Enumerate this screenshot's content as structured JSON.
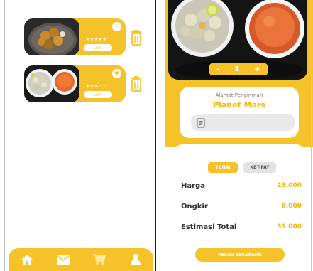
{
  "colors": {
    "accent": "#f6c229",
    "accent_text": "#f2b705",
    "dark": "#141414"
  },
  "favorites": {
    "items": [
      {
        "button_label": "LIHAT",
        "stars": "★★★★★",
        "favorite_icon": "heart-icon"
      },
      {
        "button_label": "LIHAT",
        "stars": "★★★☆☆",
        "favorite_icon": "heart-icon"
      }
    ],
    "delete_icon": "trash-icon"
  },
  "bottom_nav": {
    "items": [
      {
        "icon": "home-icon"
      },
      {
        "icon": "mail-icon"
      },
      {
        "icon": "cart-icon"
      },
      {
        "icon": "user-icon"
      }
    ]
  },
  "order": {
    "quantity": {
      "minus": "-",
      "value": "1",
      "plus": "+"
    },
    "address": {
      "label": "Alamat Pengiriman",
      "value": "Planet Mars",
      "input_icon": "document-icon"
    },
    "payment_methods": [
      {
        "label": "TUNAI",
        "selected": true
      },
      {
        "label": "KBT-PAY",
        "selected": false
      }
    ],
    "summary": [
      {
        "label": "Harga",
        "value": "23.000"
      },
      {
        "label": "Ongkir",
        "value": "8.000"
      },
      {
        "label": "Estimasi Total",
        "value": "31.000"
      }
    ],
    "submit_label": "PESAN SEKARANG"
  }
}
